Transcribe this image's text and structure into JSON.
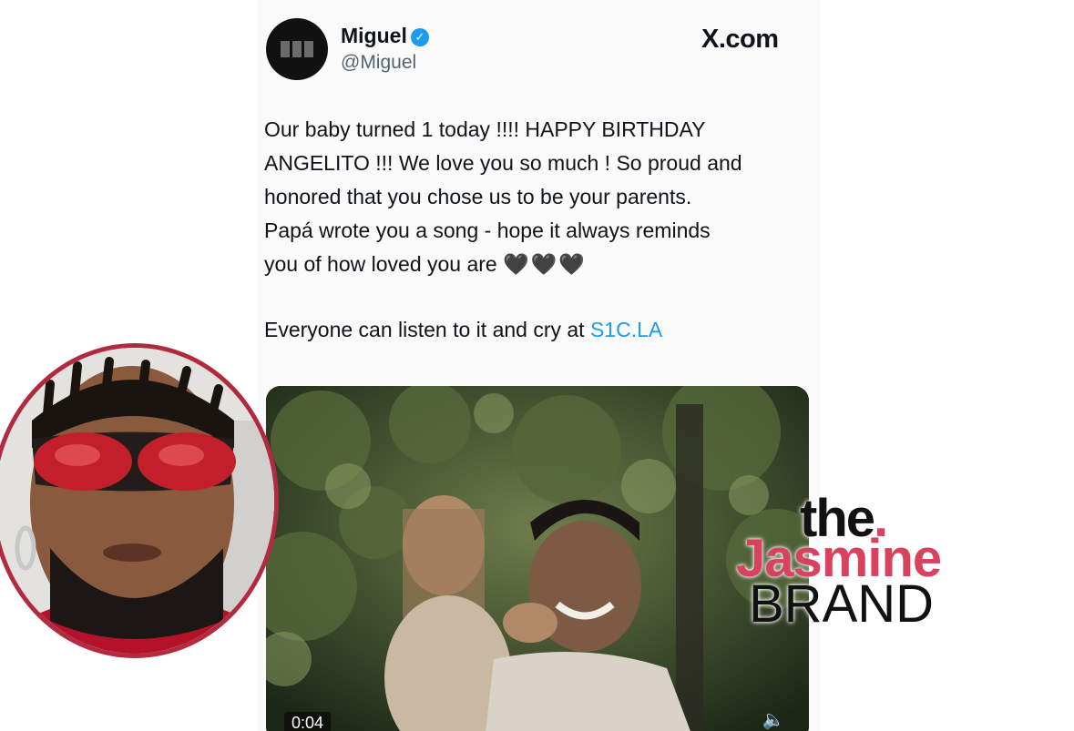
{
  "tweet": {
    "display_name": "Miguel",
    "verified": true,
    "handle": "@Miguel",
    "site_label": "X.com",
    "lines": [
      "Our baby turned 1 today !!!! HAPPY BIRTHDAY",
      "ANGELITO !!! We love you so much ! So proud and",
      "honored that you chose us to be your parents.",
      "Papá wrote you a song - hope it always reminds",
      "you of how loved you are"
    ],
    "hearts": "🖤🖤🖤",
    "second_paragraph": "Everyone can listen to it and cry at ",
    "link_text": "S1C.LA",
    "link_color": "#1d9bf0"
  },
  "video": {
    "timestamp": "0:04",
    "sound_icon": "speaker-icon"
  },
  "watermark": {
    "line1": "the",
    "line1_dot": ".",
    "line2": "Jasmine",
    "line3": "BRAND",
    "accent_color": "#d9425e"
  },
  "inset": {
    "border_color": "#b22a3f"
  }
}
